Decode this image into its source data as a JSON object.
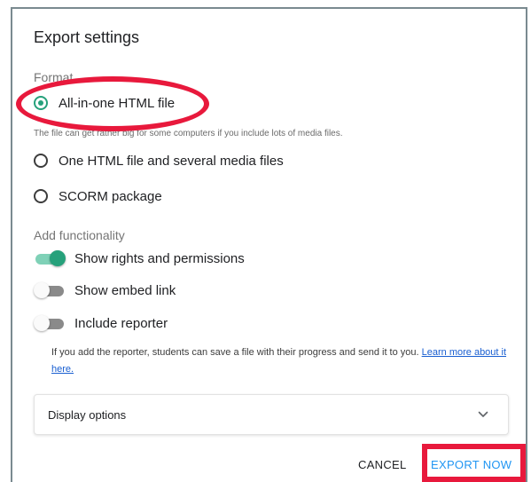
{
  "dialog": {
    "title": "Export settings"
  },
  "format": {
    "label": "Format",
    "options": [
      {
        "label": "All-in-one HTML file",
        "checked": true
      },
      {
        "label": "One HTML file and several media files",
        "checked": false
      },
      {
        "label": "SCORM package",
        "checked": false
      }
    ],
    "hint": "The file can get rather big for some computers if you include lots of media files."
  },
  "functionality": {
    "label": "Add functionality",
    "toggles": [
      {
        "label": "Show rights and permissions",
        "on": true
      },
      {
        "label": "Show embed link",
        "on": false
      },
      {
        "label": "Include reporter",
        "on": false
      }
    ],
    "reporter_note": "If you add the reporter, students can save a file with their progress and send it to you.",
    "learn_more": "Learn more about it here."
  },
  "display_options": {
    "label": "Display options",
    "icon": "chevron-down-icon"
  },
  "actions": {
    "cancel_label": "CANCEL",
    "export_label": "EXPORT NOW"
  },
  "colors": {
    "accent": "#26a17b",
    "link": "#1a5fd1",
    "primary_button": "#2196f3",
    "annotation": "#e8193c"
  }
}
